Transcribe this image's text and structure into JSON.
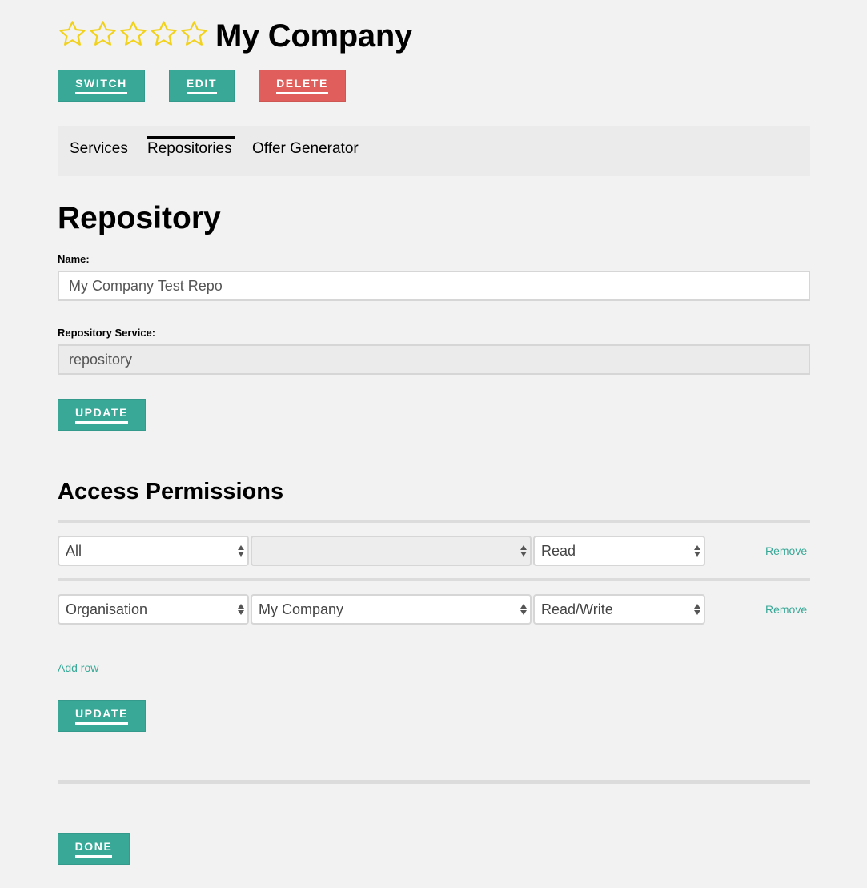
{
  "header": {
    "title": "My Company",
    "rating": {
      "value": 0,
      "max": 5,
      "star_color": "#f2d11b"
    }
  },
  "actions": {
    "switch_label": "Switch",
    "edit_label": "Edit",
    "delete_label": "Delete"
  },
  "tabs": [
    {
      "label": "Services",
      "active": false
    },
    {
      "label": "Repositories",
      "active": true
    },
    {
      "label": "Offer Generator",
      "active": false
    }
  ],
  "repository": {
    "heading": "Repository",
    "name_label": "Name:",
    "name_value": "My Company Test Repo",
    "service_label": "Repository Service:",
    "service_value": "repository",
    "update_label": "Update"
  },
  "permissions": {
    "heading": "Access Permissions",
    "rows": [
      {
        "scope": "All",
        "entity": "",
        "entity_disabled": true,
        "access": "Read",
        "remove_label": "Remove"
      },
      {
        "scope": "Organisation",
        "entity": "My Company",
        "entity_disabled": false,
        "access": "Read/Write",
        "remove_label": "Remove"
      }
    ],
    "add_row_label": "Add row",
    "update_label": "Update"
  },
  "footer": {
    "done_label": "Done"
  },
  "colors": {
    "accent": "#39a897",
    "danger": "#e05e5b",
    "background": "#f2f2f2"
  },
  "icons": {
    "star": "star-outline-icon",
    "select_arrows": "select-updown-arrows-icon"
  }
}
